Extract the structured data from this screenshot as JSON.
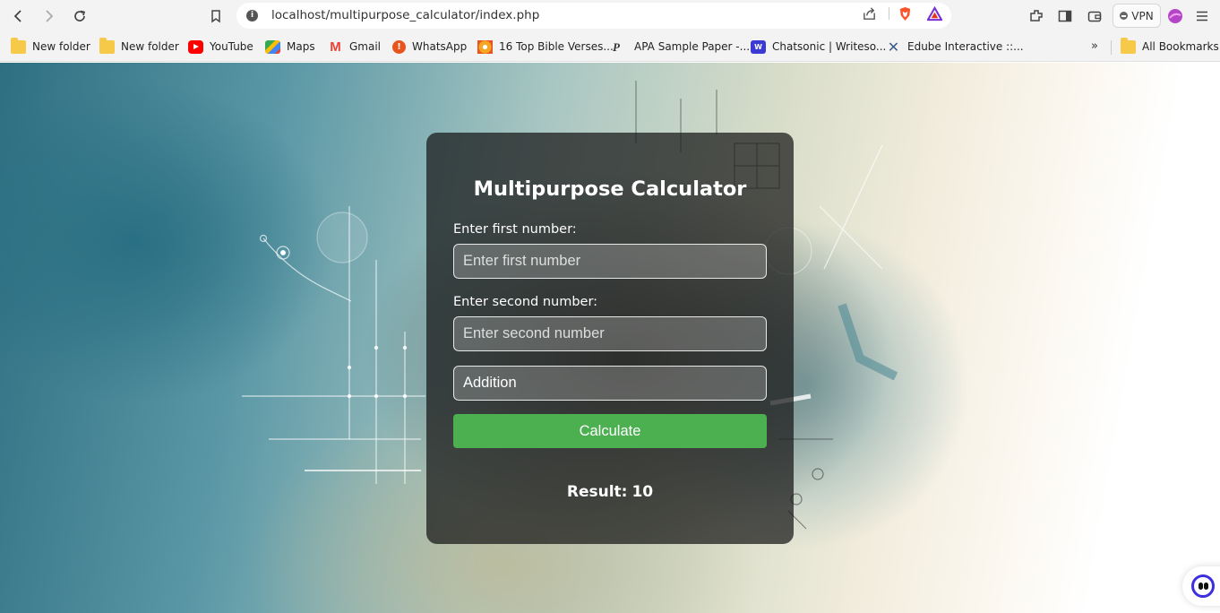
{
  "browser": {
    "url": "localhost/multipurpose_calculator/index.php",
    "vpn_label": "VPN",
    "bookmarks": [
      {
        "label": "New folder",
        "icon": "folder-icon"
      },
      {
        "label": "New folder",
        "icon": "folder-icon"
      },
      {
        "label": "YouTube",
        "icon": "youtube-icon"
      },
      {
        "label": "Maps",
        "icon": "maps-icon"
      },
      {
        "label": "Gmail",
        "icon": "gmail-icon"
      },
      {
        "label": "WhatsApp",
        "icon": "whatsapp-icon"
      },
      {
        "label": "16 Top Bible Verses...",
        "icon": "bible-icon"
      },
      {
        "label": "APA Sample Paper -...",
        "icon": "apa-icon"
      },
      {
        "label": "Chatsonic | Writeso...",
        "icon": "chatsonic-icon"
      },
      {
        "label": "Edube Interactive ::...",
        "icon": "edube-icon"
      }
    ],
    "more_bookmarks": "»",
    "all_bookmarks": "All Bookmarks"
  },
  "calculator": {
    "title": "Multipurpose Calculator",
    "first_label": "Enter first number:",
    "first_placeholder": "Enter first number",
    "second_label": "Enter second number:",
    "second_placeholder": "Enter second number",
    "operation_selected": "Addition",
    "calculate_label": "Calculate",
    "result_label": "Result:",
    "result_value": "10"
  },
  "colors": {
    "button_green": "#4caf50",
    "card_bg": "rgba(22,22,22,0.72)"
  }
}
